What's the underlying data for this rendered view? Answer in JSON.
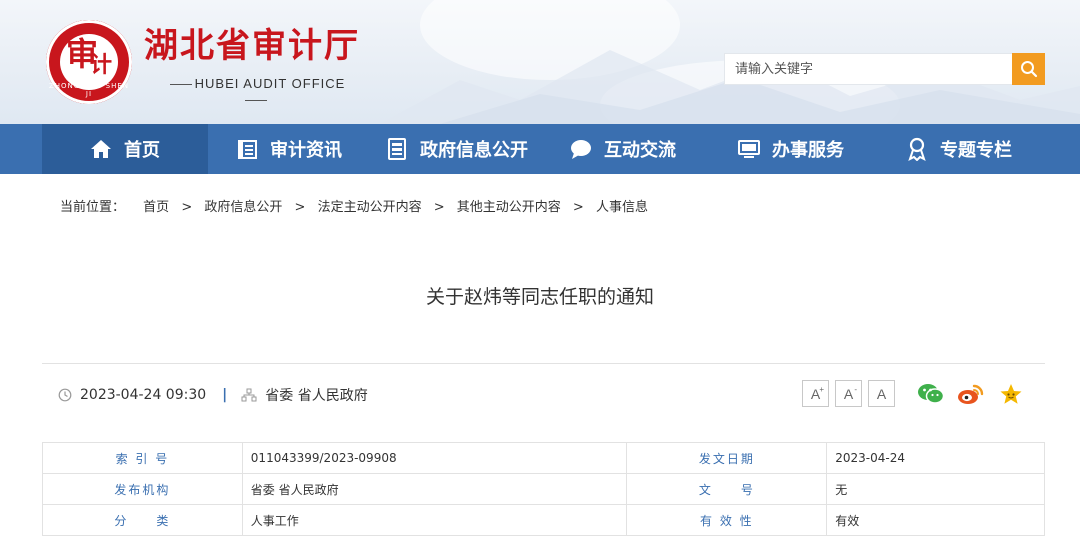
{
  "header": {
    "site_title": "湖北省审计厅",
    "site_subtitle": "HUBEI AUDIT OFFICE",
    "logo_text": "ZHONG GUO SHEN JI",
    "search_placeholder": "请输入关键字",
    "accent_color": "#c8161d",
    "search_button_color": "#f29b20"
  },
  "nav": {
    "background": "#3a6fb0",
    "items": [
      {
        "label": "首页",
        "icon": "home-icon"
      },
      {
        "label": "审计资讯",
        "icon": "news-icon"
      },
      {
        "label": "政府信息公开",
        "icon": "document-icon"
      },
      {
        "label": "互动交流",
        "icon": "chat-icon"
      },
      {
        "label": "办事服务",
        "icon": "monitor-icon"
      },
      {
        "label": "专题专栏",
        "icon": "ribbon-icon"
      }
    ]
  },
  "breadcrumb": {
    "lead": "当前位置：",
    "items": [
      "首页",
      "政府信息公开",
      "法定主动公开内容",
      "其他主动公开内容",
      "人事信息"
    ],
    "separator": ">"
  },
  "article": {
    "title": "关于赵炜等同志任职的通知",
    "datetime": "2023-04-24 09:30",
    "divider": "|",
    "source": "省委 省人民政府",
    "font_buttons": [
      "A",
      "A",
      "A"
    ],
    "share_icons": [
      "wechat-icon",
      "weibo-icon",
      "favorite-icon"
    ]
  },
  "info_table": {
    "rows": [
      {
        "k1": "索 引 号",
        "v1": "011043399/2023-09908",
        "k2": "发文日期",
        "v2": "2023-04-24"
      },
      {
        "k1": "发布机构",
        "v1": "省委 省人民政府",
        "k2": "文　　号",
        "v2": "无"
      },
      {
        "k1": "分　　类",
        "v1": "人事工作",
        "k2": "有 效 性",
        "v2": "有效"
      }
    ]
  }
}
